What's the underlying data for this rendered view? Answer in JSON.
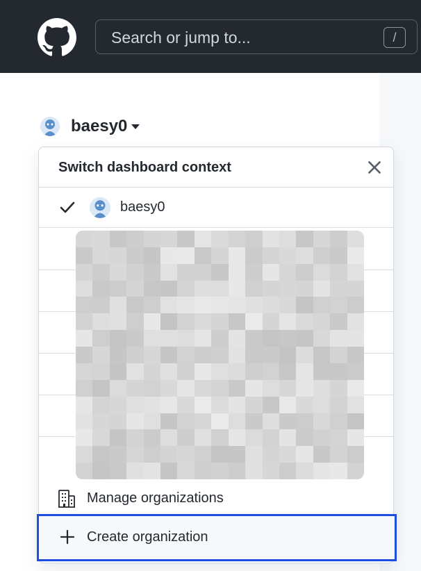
{
  "header": {
    "logo_icon": "github-mark-icon",
    "search_placeholder": "Search or jump to...",
    "search_shortcut": "/"
  },
  "context": {
    "user": "baesy0"
  },
  "panel": {
    "title": "Switch dashboard context",
    "close_icon": "close-icon",
    "current_user": "baesy0",
    "manage_label": "Manage organizations",
    "create_label": "Create organization"
  },
  "colors": {
    "header_bg": "#24292f",
    "highlight_border": "#1f4de0"
  }
}
